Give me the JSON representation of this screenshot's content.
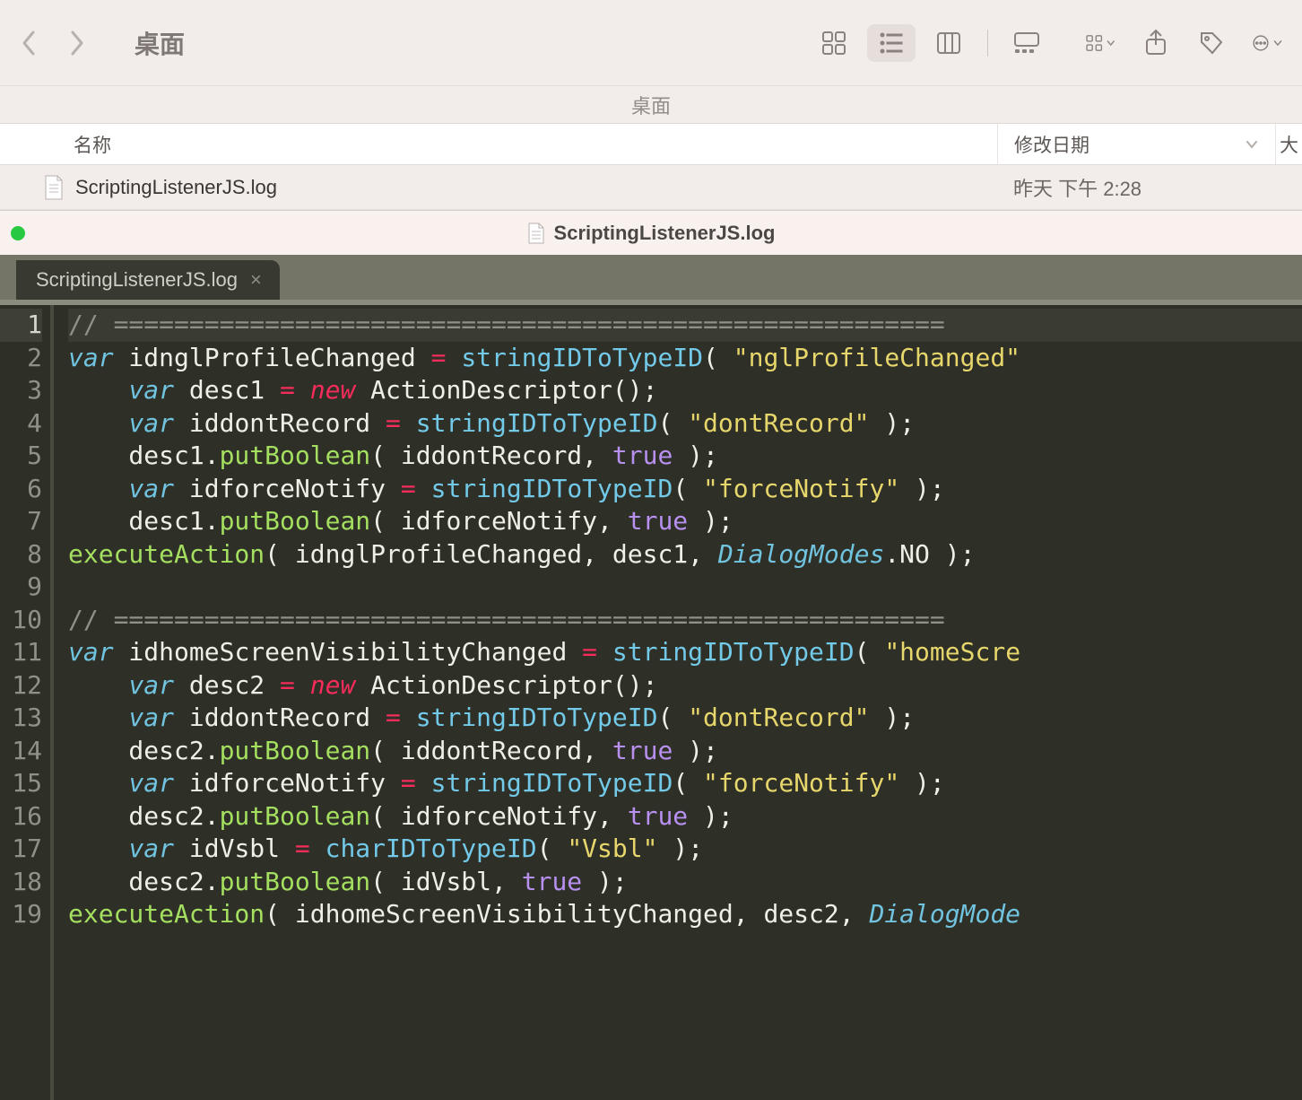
{
  "finder": {
    "location_title": "桌面",
    "pathbar": "桌面",
    "columns": {
      "name": "名称",
      "modified": "修改日期",
      "size": "大"
    },
    "row": {
      "filename": "ScriptingListenerJS.log",
      "modified": "昨天 下午 2:28"
    }
  },
  "editor": {
    "titlebar": "ScriptingListenerJS.log",
    "tab": "ScriptingListenerJS.log"
  },
  "code": {
    "lines": [
      {
        "n": 1,
        "tokens": [
          {
            "t": "comment",
            "v": "// "
          },
          {
            "t": "comment",
            "v": "======================================================="
          }
        ]
      },
      {
        "n": 2,
        "tokens": [
          {
            "t": "kw",
            "v": "var"
          },
          {
            "t": "plain",
            "v": " idnglProfileChanged "
          },
          {
            "t": "op",
            "v": "="
          },
          {
            "t": "plain",
            "v": " "
          },
          {
            "t": "fn",
            "v": "stringIDToTypeID"
          },
          {
            "t": "plain",
            "v": "( "
          },
          {
            "t": "str",
            "v": "\"nglProfileChanged\""
          }
        ]
      },
      {
        "n": 3,
        "tokens": [
          {
            "t": "plain",
            "v": "    "
          },
          {
            "t": "kw",
            "v": "var"
          },
          {
            "t": "plain",
            "v": " desc1 "
          },
          {
            "t": "op",
            "v": "="
          },
          {
            "t": "plain",
            "v": " "
          },
          {
            "t": "new",
            "v": "new"
          },
          {
            "t": "plain",
            "v": " ActionDescriptor();"
          }
        ]
      },
      {
        "n": 4,
        "tokens": [
          {
            "t": "plain",
            "v": "    "
          },
          {
            "t": "kw",
            "v": "var"
          },
          {
            "t": "plain",
            "v": " iddontRecord "
          },
          {
            "t": "op",
            "v": "="
          },
          {
            "t": "plain",
            "v": " "
          },
          {
            "t": "fn",
            "v": "stringIDToTypeID"
          },
          {
            "t": "plain",
            "v": "( "
          },
          {
            "t": "str",
            "v": "\"dontRecord\""
          },
          {
            "t": "plain",
            "v": " );"
          }
        ]
      },
      {
        "n": 5,
        "tokens": [
          {
            "t": "plain",
            "v": "    desc1."
          },
          {
            "t": "call",
            "v": "putBoolean"
          },
          {
            "t": "plain",
            "v": "( iddontRecord, "
          },
          {
            "t": "bool",
            "v": "true"
          },
          {
            "t": "plain",
            "v": " );"
          }
        ]
      },
      {
        "n": 6,
        "tokens": [
          {
            "t": "plain",
            "v": "    "
          },
          {
            "t": "kw",
            "v": "var"
          },
          {
            "t": "plain",
            "v": " idforceNotify "
          },
          {
            "t": "op",
            "v": "="
          },
          {
            "t": "plain",
            "v": " "
          },
          {
            "t": "fn",
            "v": "stringIDToTypeID"
          },
          {
            "t": "plain",
            "v": "( "
          },
          {
            "t": "str",
            "v": "\"forceNotify\""
          },
          {
            "t": "plain",
            "v": " );"
          }
        ]
      },
      {
        "n": 7,
        "tokens": [
          {
            "t": "plain",
            "v": "    desc1."
          },
          {
            "t": "call",
            "v": "putBoolean"
          },
          {
            "t": "plain",
            "v": "( idforceNotify, "
          },
          {
            "t": "bool",
            "v": "true"
          },
          {
            "t": "plain",
            "v": " );"
          }
        ]
      },
      {
        "n": 8,
        "tokens": [
          {
            "t": "call",
            "v": "executeAction"
          },
          {
            "t": "plain",
            "v": "( idnglProfileChanged, desc1, "
          },
          {
            "t": "type",
            "v": "DialogModes"
          },
          {
            "t": "plain",
            "v": ".NO );"
          }
        ]
      },
      {
        "n": 9,
        "tokens": [
          {
            "t": "plain",
            "v": ""
          }
        ]
      },
      {
        "n": 10,
        "tokens": [
          {
            "t": "comment",
            "v": "// "
          },
          {
            "t": "comment",
            "v": "======================================================="
          }
        ]
      },
      {
        "n": 11,
        "tokens": [
          {
            "t": "kw",
            "v": "var"
          },
          {
            "t": "plain",
            "v": " idhomeScreenVisibilityChanged "
          },
          {
            "t": "op",
            "v": "="
          },
          {
            "t": "plain",
            "v": " "
          },
          {
            "t": "fn",
            "v": "stringIDToTypeID"
          },
          {
            "t": "plain",
            "v": "( "
          },
          {
            "t": "str",
            "v": "\"homeScre"
          }
        ]
      },
      {
        "n": 12,
        "tokens": [
          {
            "t": "plain",
            "v": "    "
          },
          {
            "t": "kw",
            "v": "var"
          },
          {
            "t": "plain",
            "v": " desc2 "
          },
          {
            "t": "op",
            "v": "="
          },
          {
            "t": "plain",
            "v": " "
          },
          {
            "t": "new",
            "v": "new"
          },
          {
            "t": "plain",
            "v": " ActionDescriptor();"
          }
        ]
      },
      {
        "n": 13,
        "tokens": [
          {
            "t": "plain",
            "v": "    "
          },
          {
            "t": "kw",
            "v": "var"
          },
          {
            "t": "plain",
            "v": " iddontRecord "
          },
          {
            "t": "op",
            "v": "="
          },
          {
            "t": "plain",
            "v": " "
          },
          {
            "t": "fn",
            "v": "stringIDToTypeID"
          },
          {
            "t": "plain",
            "v": "( "
          },
          {
            "t": "str",
            "v": "\"dontRecord\""
          },
          {
            "t": "plain",
            "v": " );"
          }
        ]
      },
      {
        "n": 14,
        "tokens": [
          {
            "t": "plain",
            "v": "    desc2."
          },
          {
            "t": "call",
            "v": "putBoolean"
          },
          {
            "t": "plain",
            "v": "( iddontRecord, "
          },
          {
            "t": "bool",
            "v": "true"
          },
          {
            "t": "plain",
            "v": " );"
          }
        ]
      },
      {
        "n": 15,
        "tokens": [
          {
            "t": "plain",
            "v": "    "
          },
          {
            "t": "kw",
            "v": "var"
          },
          {
            "t": "plain",
            "v": " idforceNotify "
          },
          {
            "t": "op",
            "v": "="
          },
          {
            "t": "plain",
            "v": " "
          },
          {
            "t": "fn",
            "v": "stringIDToTypeID"
          },
          {
            "t": "plain",
            "v": "( "
          },
          {
            "t": "str",
            "v": "\"forceNotify\""
          },
          {
            "t": "plain",
            "v": " );"
          }
        ]
      },
      {
        "n": 16,
        "tokens": [
          {
            "t": "plain",
            "v": "    desc2."
          },
          {
            "t": "call",
            "v": "putBoolean"
          },
          {
            "t": "plain",
            "v": "( idforceNotify, "
          },
          {
            "t": "bool",
            "v": "true"
          },
          {
            "t": "plain",
            "v": " );"
          }
        ]
      },
      {
        "n": 17,
        "tokens": [
          {
            "t": "plain",
            "v": "    "
          },
          {
            "t": "kw",
            "v": "var"
          },
          {
            "t": "plain",
            "v": " idVsbl "
          },
          {
            "t": "op",
            "v": "="
          },
          {
            "t": "plain",
            "v": " "
          },
          {
            "t": "fn",
            "v": "charIDToTypeID"
          },
          {
            "t": "plain",
            "v": "( "
          },
          {
            "t": "str",
            "v": "\"Vsbl\""
          },
          {
            "t": "plain",
            "v": " );"
          }
        ]
      },
      {
        "n": 18,
        "tokens": [
          {
            "t": "plain",
            "v": "    desc2."
          },
          {
            "t": "call",
            "v": "putBoolean"
          },
          {
            "t": "plain",
            "v": "( idVsbl, "
          },
          {
            "t": "bool",
            "v": "true"
          },
          {
            "t": "plain",
            "v": " );"
          }
        ]
      },
      {
        "n": 19,
        "tokens": [
          {
            "t": "call",
            "v": "executeAction"
          },
          {
            "t": "plain",
            "v": "( idhomeScreenVisibilityChanged, desc2, "
          },
          {
            "t": "type",
            "v": "DialogMode"
          }
        ]
      }
    ]
  }
}
